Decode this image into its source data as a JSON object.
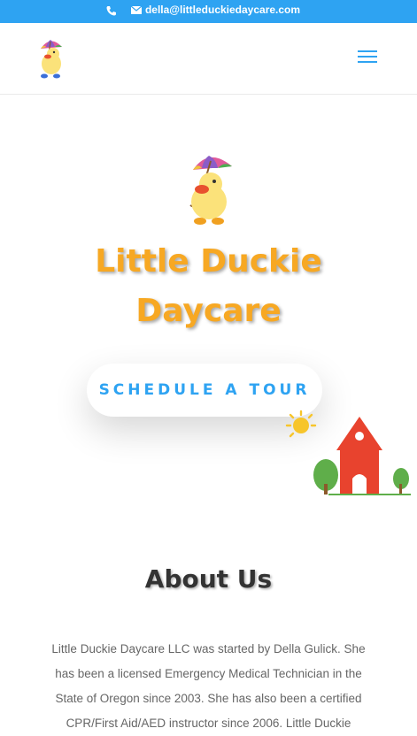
{
  "topbar": {
    "email": "della@littleduckiedaycare.com",
    "phone_icon": "phone-icon",
    "mail_icon": "envelope-icon"
  },
  "header": {
    "logo_icon": "duck-logo-icon",
    "menu_icon": "hamburger-menu-icon"
  },
  "hero": {
    "title_line1": "Little Duckie",
    "title_line2": "Daycare",
    "button_label": "SCHEDULE A TOUR",
    "duck_icon": "duck-umbrella-icon",
    "school_icon": "schoolhouse-illustration"
  },
  "about": {
    "title": "About Us",
    "lines": [
      "Little Duckie Daycare LLC was started by Della Gulick.  She",
      "has been a licensed Emergency Medical Technician in the",
      "State of Oregon since 2003.  She has also been a certified",
      "CPR/First Aid/AED instructor since 2006.  Little Duckie"
    ]
  },
  "colors": {
    "accent": "#2ea3f2",
    "title": "#f7a823",
    "body_text": "#666666"
  }
}
